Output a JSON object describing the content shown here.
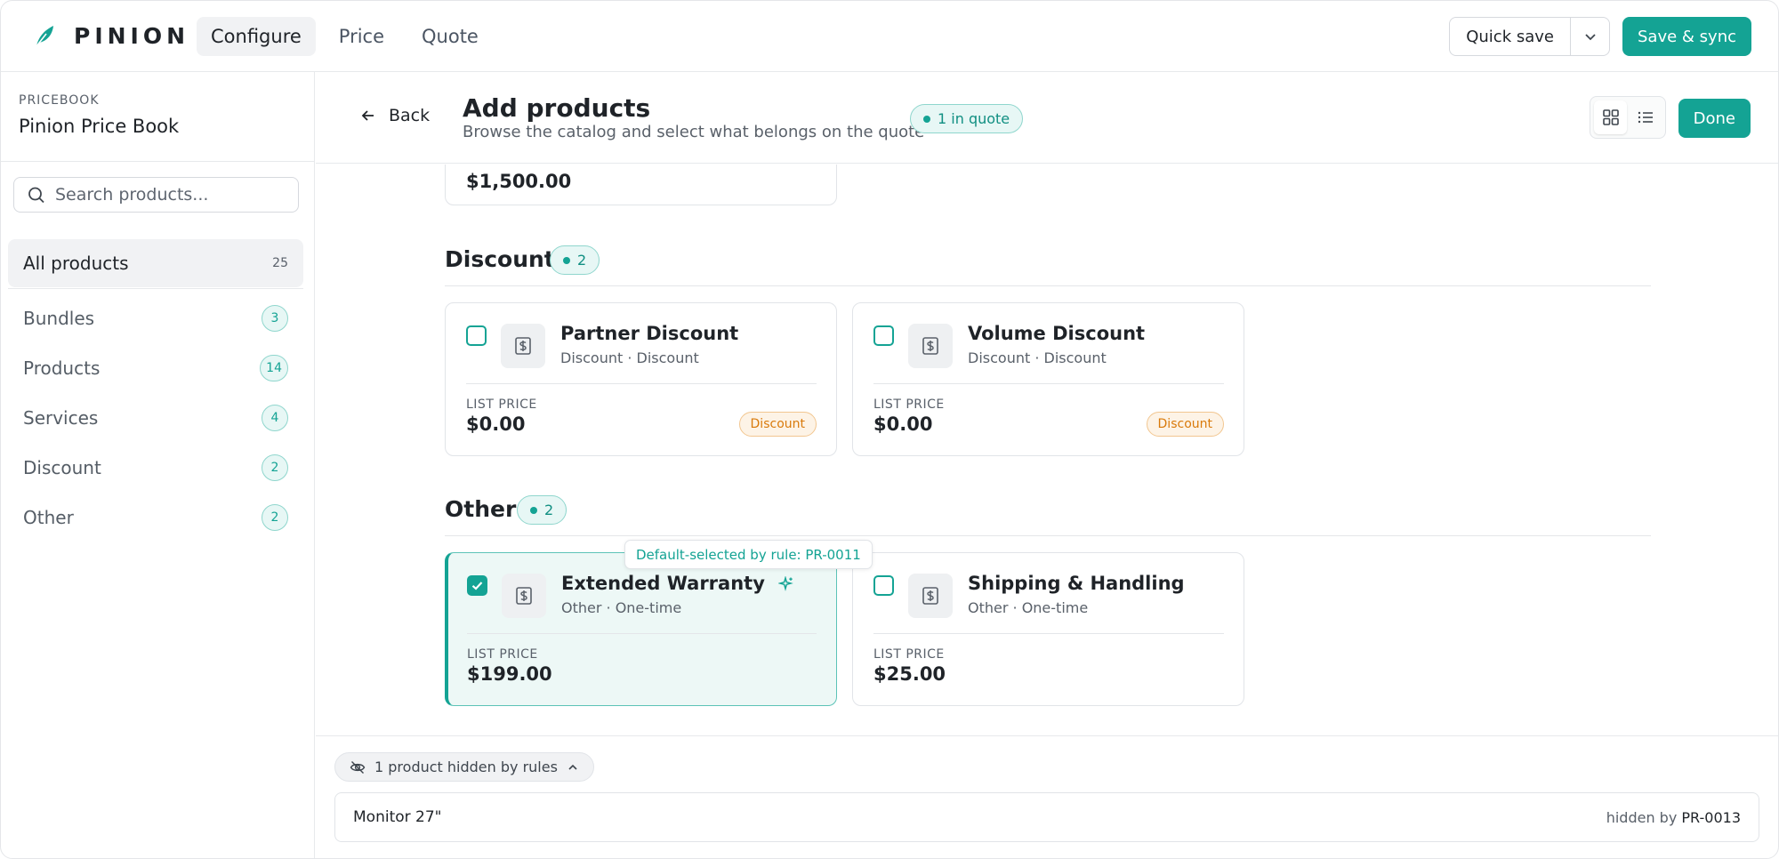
{
  "brand": {
    "name": "PINION"
  },
  "nav": {
    "tabs": [
      {
        "label": "Configure",
        "active": true
      },
      {
        "label": "Price"
      },
      {
        "label": "Quote"
      }
    ]
  },
  "toolbar": {
    "quick_save": "Quick save",
    "save_sync": "Save & sync"
  },
  "sidebar": {
    "pricebook_label": "PRICEBOOK",
    "pricebook_name": "Pinion Price Book",
    "search_placeholder": "Search products...",
    "all": {
      "label": "All products",
      "count": "25"
    },
    "categories": [
      {
        "label": "Bundles",
        "count": "3"
      },
      {
        "label": "Products",
        "count": "14"
      },
      {
        "label": "Services",
        "count": "4"
      },
      {
        "label": "Discount",
        "count": "2"
      },
      {
        "label": "Other",
        "count": "2"
      }
    ]
  },
  "header": {
    "back": "Back",
    "title": "Add products",
    "subtitle": "Browse the catalog and select what belongs on the quote",
    "quote_pill": "1 in quote",
    "done": "Done"
  },
  "content": {
    "prev_price": "$1,500.00",
    "sections": [
      {
        "title": "Discount",
        "count": "2",
        "cards": [
          {
            "name": "Partner Discount",
            "meta": "Discount · Discount",
            "list_label": "LIST PRICE",
            "price": "$0.00",
            "badge": "Discount",
            "selected": false
          },
          {
            "name": "Volume Discount",
            "meta": "Discount · Discount",
            "list_label": "LIST PRICE",
            "price": "$0.00",
            "badge": "Discount",
            "selected": false
          }
        ]
      },
      {
        "title": "Other",
        "count": "2",
        "cards": [
          {
            "name": "Extended Warranty",
            "meta": "Other · One-time",
            "list_label": "LIST PRICE",
            "price": "$199.00",
            "selected": true
          },
          {
            "name": "Shipping & Handling",
            "meta": "Other · One-time",
            "list_label": "LIST PRICE",
            "price": "$25.00",
            "selected": false
          }
        ]
      }
    ],
    "tooltip": "Default-selected by rule: PR-0011"
  },
  "hidden": {
    "pill": "1 product hidden by rules",
    "rows": [
      {
        "name": "Monitor 27\"",
        "prefix": "hidden by",
        "rule": "PR-0013"
      }
    ]
  },
  "colors": {
    "accent": "#14a394",
    "badge_orange": "#d97a0b"
  },
  "icons": [
    "leaf-logo-icon",
    "chevron-down-icon",
    "search-icon",
    "arrow-left-icon",
    "grid-view-icon",
    "list-view-icon",
    "dollar-document-icon",
    "check-icon",
    "sparkle-icon",
    "eye-off-icon",
    "chevron-up-icon"
  ]
}
